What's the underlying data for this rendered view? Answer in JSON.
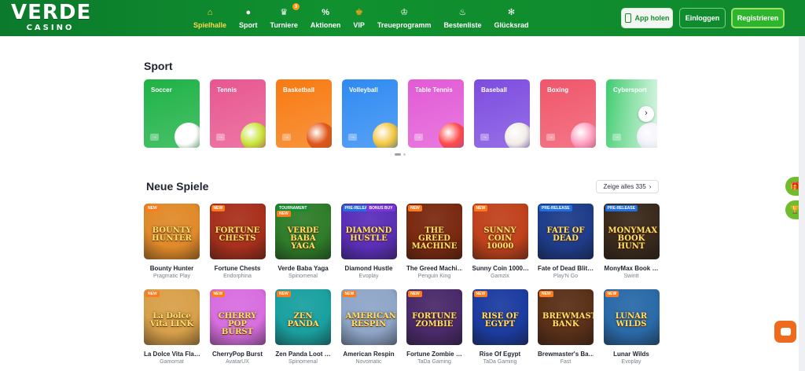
{
  "brand": {
    "line1": "VERDE",
    "line2": "CASINO"
  },
  "nav": [
    {
      "label": "Spielhalle",
      "icon": "home-icon",
      "glyph": "⌂",
      "active": true
    },
    {
      "label": "Sport",
      "icon": "ball-icon",
      "glyph": "●"
    },
    {
      "label": "Turniere",
      "icon": "trophy-icon",
      "glyph": "♛",
      "badge": "3"
    },
    {
      "label": "Aktionen",
      "icon": "percent-icon",
      "glyph": "%"
    },
    {
      "label": "VIP",
      "icon": "crown-icon",
      "glyph": "♚",
      "color": "#f6a21a"
    },
    {
      "label": "Treueprogramm",
      "icon": "crown-outline-icon",
      "glyph": "♔"
    },
    {
      "label": "Bestenliste",
      "icon": "flame-icon",
      "glyph": "♨"
    },
    {
      "label": "Glücksrad",
      "icon": "wheel-icon",
      "glyph": "✻"
    }
  ],
  "header_buttons": {
    "app": "App holen",
    "login": "Einloggen",
    "register": "Registrieren"
  },
  "sport": {
    "title": "Sport",
    "tiles": [
      {
        "name": "Soccer",
        "bg": "#1db245",
        "ball": "#ffffff"
      },
      {
        "name": "Tennis",
        "bg": "#e8568f",
        "ball": "#c8e436"
      },
      {
        "name": "Basketball",
        "bg": "#f77a10",
        "ball": "#e0561a"
      },
      {
        "name": "Volleyball",
        "bg": "#2e8af2",
        "ball": "#f2c640"
      },
      {
        "name": "Table Tennis",
        "bg": "#e25ad6",
        "ball": "#ff4a4a"
      },
      {
        "name": "Baseball",
        "bg": "#7d4ce0",
        "ball": "#f1ece6"
      },
      {
        "name": "Boxing",
        "bg": "#f0556a",
        "ball": "#ff9fc0"
      },
      {
        "name": "Cybersport",
        "bg": "#3ccc6c",
        "ball": "#dcdcf2"
      }
    ]
  },
  "games": {
    "title": "Neue Spiele",
    "show_all": "Zeige alles 335",
    "items": [
      {
        "name": "Bounty Hunter",
        "provider": "Pragmatic Play",
        "bg": "#e08a2a",
        "art": "BOUNTY HUNTER",
        "tag": "NEW"
      },
      {
        "name": "Fortune Chests",
        "provider": "Endorphina",
        "bg": "#a8301c",
        "art": "FORTUNE CHESTS",
        "tag": "NEW"
      },
      {
        "name": "Verde Baba Yaga",
        "provider": "Spinomenal",
        "bg": "#2f7d2a",
        "art": "VERDE BABA YAGA",
        "tag": "TOURNAMENT",
        "tag2": "NEW"
      },
      {
        "name": "Diamond Hustle",
        "provider": "Evoplay",
        "bg": "#5a2fb8",
        "art": "DIAMOND HUSTLE",
        "tag": "PRE-RELEASE",
        "tag3": "BONUS BUY"
      },
      {
        "name": "The Greed Machi…",
        "provider": "Penguin King",
        "bg": "#7a2a10",
        "art": "THE GREED MACHINE",
        "tag": "NEW"
      },
      {
        "name": "Sunny Coin 1000…",
        "provider": "Gamzix",
        "bg": "#c0421c",
        "art": "SUNNY COIN 10000",
        "tag": "NEW"
      },
      {
        "name": "Fate of Dead Blit…",
        "provider": "Play'N Go",
        "bg": "#1e3c8a",
        "art": "FATE OF DEAD",
        "tag": "PRE-RELEASE"
      },
      {
        "name": "MonyMax Book …",
        "provider": "Swintt",
        "bg": "#3a2a1c",
        "art": "MONYMAX BOOK HUNT",
        "tag": "PRE-RELEASE"
      },
      {
        "name": "La Dolce Vita Fla…",
        "provider": "Gamomat",
        "bg": "#d8a04a",
        "art": "La Dolce Vita LINK",
        "tag": "NEW"
      },
      {
        "name": "CherryPop Burst",
        "provider": "AvatarUX",
        "bg": "#d86ee0",
        "art": "CHERRY POP BURST",
        "tag": "NEW"
      },
      {
        "name": "Zen Panda Loot …",
        "provider": "Spinomenal",
        "bg": "#1aa0a0",
        "art": "ZEN PANDA",
        "tag": "NEW"
      },
      {
        "name": "American Respin",
        "provider": "Novomatic",
        "bg": "#8fa6c8",
        "art": "AMERICAN RESPIN",
        "tag": "NEW"
      },
      {
        "name": "Fortune Zombie …",
        "provider": "TaDa Gaming",
        "bg": "#4a2a6a",
        "art": "FORTUNE ZOMBIE",
        "tag": "NEW"
      },
      {
        "name": "Rise Of Egypt",
        "provider": "TaDa Gaming",
        "bg": "#1c3ca0",
        "art": "RISE OF EGYPT",
        "tag": "NEW"
      },
      {
        "name": "Brewmaster's Ba…",
        "provider": "Fast",
        "bg": "#5a3018",
        "art": "BREWMASTER BANK",
        "tag": "NEW"
      },
      {
        "name": "Lunar Wilds",
        "provider": "Evoplay",
        "bg": "#2a6aa8",
        "art": "LUNAR WILDS",
        "tag": "NEW"
      }
    ]
  }
}
